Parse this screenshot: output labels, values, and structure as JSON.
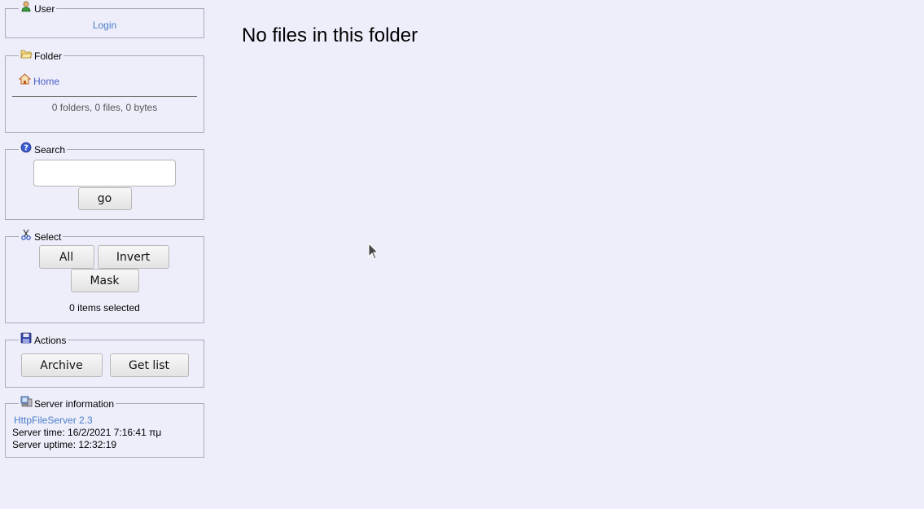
{
  "user": {
    "legend": "User",
    "login_label": "Login"
  },
  "folder": {
    "legend": "Folder",
    "home_label": "Home",
    "summary": "0 folders, 0 files, 0 bytes"
  },
  "search": {
    "legend": "Search",
    "input_value": "",
    "go_label": "go"
  },
  "select": {
    "legend": "Select",
    "all_label": "All",
    "invert_label": "Invert",
    "mask_label": "Mask",
    "selected_text": "0 items selected"
  },
  "actions": {
    "legend": "Actions",
    "archive_label": "Archive",
    "getlist_label": "Get list"
  },
  "server": {
    "legend": "Server information",
    "software_label": "HttpFileServer 2.3",
    "time_text": "Server time: 16/2/2021 7:16:41 πμ",
    "uptime_text": "Server uptime: 12:32:19"
  },
  "main": {
    "message": "No files in this folder"
  },
  "icons": {
    "user": "user-icon",
    "folder": "folder-icon",
    "search": "help-icon",
    "select": "scissors-icon",
    "actions": "floppy-disk-icon",
    "server": "server-icon",
    "home": "home-icon"
  }
}
